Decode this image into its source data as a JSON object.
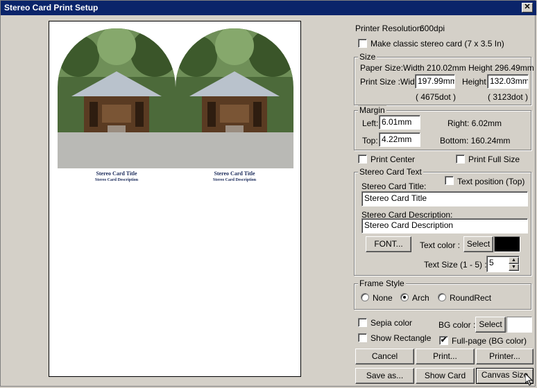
{
  "window": {
    "title": "Stereo Card Print Setup",
    "close_glyph": "✕"
  },
  "preview": {
    "card_title": "Stereo Card Title",
    "card_description": "Stereo Card Description"
  },
  "printer_resolution": {
    "label": "Printer Resolution:",
    "value": "600dpi"
  },
  "classic": {
    "label": "Make classic stereo card (7 x 3.5 In)",
    "checked": false
  },
  "size": {
    "title": "Size",
    "paper_size": "Paper Size:Width 210.02mm Height 296.49mm",
    "print_size_label": "Print Size :Width",
    "width_value": "197.99mm",
    "height_label": "Height",
    "height_value": "132.03mm",
    "width_dots": "( 4675dot )",
    "height_dots": "( 3123dot )"
  },
  "margin": {
    "title": "Margin",
    "left_label": "Left:",
    "left_value": "6.01mm",
    "right_text": "Right:  6.02mm",
    "top_label": "Top:",
    "top_value": "4.22mm",
    "bottom_text": "Bottom:   160.24mm"
  },
  "print_center": {
    "label": "Print Center",
    "checked": false
  },
  "print_full_size": {
    "label": "Print Full Size",
    "checked": false
  },
  "stereo_text": {
    "title": "Stereo Card Text",
    "title_label": "Stereo Card Title:",
    "text_position_label": "Text position (Top)",
    "title_value": "Stereo Card Title",
    "description_label": "Stereo Card Description:",
    "description_value": "Stereo Card Description",
    "font_button": "FONT...",
    "text_color_label": "Text color :",
    "select_button": "Select",
    "text_color": "#000000",
    "text_size_label": "Text Size (1 - 5) :",
    "text_size_value": "5"
  },
  "frame_style": {
    "title": "Frame Style",
    "options": [
      "None",
      "Arch",
      "RoundRect"
    ],
    "selected": "Arch"
  },
  "sepia": {
    "label": "Sepia color",
    "checked": false
  },
  "show_rectangle": {
    "label": "Show Rectangle",
    "checked": false
  },
  "bg_color": {
    "label": "BG color :",
    "select_button": "Select",
    "color": "#ffffff"
  },
  "full_page": {
    "label": "Full-page (BG color)",
    "checked": true
  },
  "buttons": {
    "cancel": "Cancel",
    "print": "Print...",
    "printer": "Printer...",
    "save_as": "Save as...",
    "show_card": "Show Card",
    "canvas_size": "Canvas Size"
  }
}
